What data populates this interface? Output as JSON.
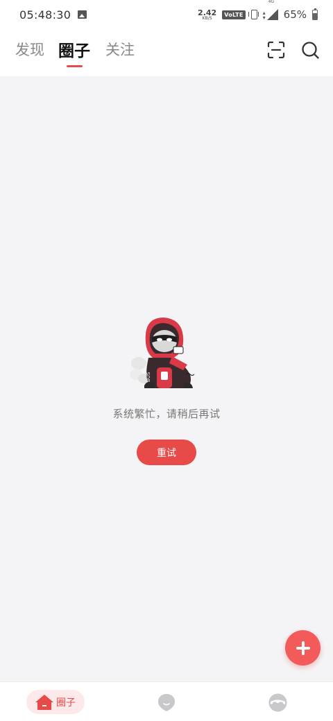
{
  "status_bar": {
    "time": "05:48:30",
    "net_speed_value": "2.42",
    "net_speed_unit": "KB/S",
    "volte": "VoLTE",
    "signal_label": "4G",
    "battery_percent": "65%",
    "battery_level": 0.65
  },
  "header": {
    "tabs": [
      {
        "label": "发现",
        "active": false
      },
      {
        "label": "圈子",
        "active": true
      },
      {
        "label": "关注",
        "active": false
      }
    ]
  },
  "content": {
    "error_message": "系统繁忙，请稍后再试",
    "retry_label": "重试"
  },
  "bottom_nav": {
    "items": [
      {
        "label": "圈子",
        "icon": "home-icon",
        "active": true
      },
      {
        "icon": "message-icon",
        "active": false
      },
      {
        "icon": "profile-mask-icon",
        "active": false
      }
    ]
  },
  "colors": {
    "accent": "#e84a4a",
    "fab": "#f35a5a",
    "background": "#f4f4f6",
    "nav_active_bg": "#fde9e9"
  }
}
